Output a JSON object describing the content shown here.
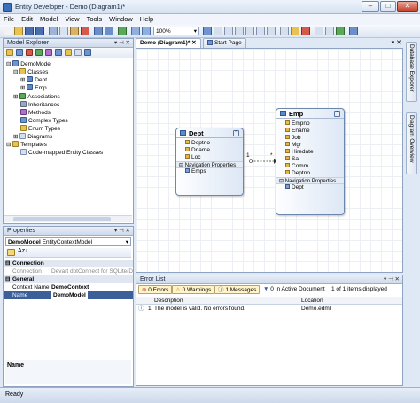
{
  "window": {
    "title": "Entity Developer - Demo (Diagram1)*"
  },
  "menu": [
    "File",
    "Edit",
    "Model",
    "View",
    "Tools",
    "Window",
    "Help"
  ],
  "toolbar": {
    "zoom": "100%"
  },
  "explorer": {
    "title": "Model Explorer",
    "tree": [
      {
        "label": "DemoModel",
        "level": 0,
        "icon": "model-icon"
      },
      {
        "label": "Classes",
        "level": 1,
        "icon": "folder-icon"
      },
      {
        "label": "Dept",
        "level": 2,
        "icon": "class-icon"
      },
      {
        "label": "Emp",
        "level": 2,
        "icon": "class-icon"
      },
      {
        "label": "Associations",
        "level": 1,
        "icon": "association-icon"
      },
      {
        "label": "Inheritances",
        "level": 1,
        "icon": "inheritance-icon"
      },
      {
        "label": "Methods",
        "level": 1,
        "icon": "method-icon"
      },
      {
        "label": "Complex Types",
        "level": 1,
        "icon": "complex-type-icon"
      },
      {
        "label": "Enum Types",
        "level": 1,
        "icon": "enum-icon"
      },
      {
        "label": "Diagrams",
        "level": 1,
        "icon": "diagram-icon"
      },
      {
        "label": "Templates",
        "level": 0,
        "icon": "folder-icon"
      },
      {
        "label": "Code-mapped Entity Classes",
        "level": 1,
        "icon": "template-icon"
      }
    ]
  },
  "properties": {
    "title": "Properties",
    "object_name": "DemoModel",
    "object_type": "EntityContextModel",
    "rows": [
      {
        "kind": "cat",
        "name": "Connection",
        "value": ""
      },
      {
        "kind": "prop",
        "name": "Connection",
        "value": "Devart dotConnect for SQLite(Data"
      },
      {
        "kind": "cat",
        "name": "General",
        "value": ""
      },
      {
        "kind": "prop",
        "name": "Context Name",
        "value": "DemoContext"
      },
      {
        "kind": "prop",
        "name": "Name",
        "value": "DemoModel"
      }
    ],
    "desc_title": "Name"
  },
  "tabs": [
    {
      "label": "Demo (Diagram1)*"
    },
    {
      "label": "Start Page"
    }
  ],
  "diagram": {
    "dept": {
      "title": "Dept",
      "fields": [
        "Deptno",
        "Dname",
        "Loc"
      ],
      "nav_label": "Navigation Properties",
      "nav": [
        "Emps"
      ]
    },
    "emp": {
      "title": "Emp",
      "fields": [
        "Empno",
        "Ename",
        "Job",
        "Mgr",
        "Hiredate",
        "Sal",
        "Comm",
        "Deptno"
      ],
      "nav_label": "Navigation Properties",
      "nav": [
        "Dept"
      ]
    },
    "assoc": {
      "from_mult": "1",
      "to_mult": "*"
    }
  },
  "sidebar_tabs": [
    "Database Explorer",
    "Diagram Overview"
  ],
  "errors": {
    "title": "Error List",
    "errors_btn": "0 Errors",
    "warnings_btn": "0 Warnings",
    "messages_btn": "1 Messages",
    "filter_label": "0 In Active Document",
    "pager": "1 of 1 items displayed",
    "headers": [
      "Description",
      "Location"
    ],
    "rows": [
      {
        "num": "1",
        "description": "The model is valid. No errors found.",
        "location": "Demo.edml"
      }
    ]
  },
  "status": "Ready"
}
